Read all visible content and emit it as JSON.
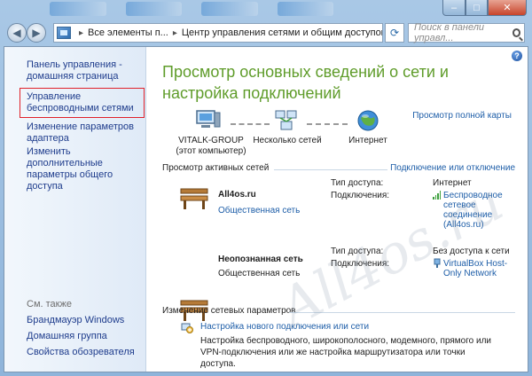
{
  "window": {
    "controls": {
      "minimize": "–",
      "maximize": "□",
      "close": "✕"
    }
  },
  "nav": {
    "back_icon": "back-arrow-icon",
    "forward_icon": "forward-arrow-icon",
    "address": {
      "crumbs": [
        "Все элементы п...",
        "Центр управления сетями и общим доступом"
      ],
      "separator": "▸"
    },
    "search_placeholder": "Поиск в панели управл..."
  },
  "sidebar": {
    "items": [
      {
        "label": "Панель управления - домашняя страница"
      },
      {
        "label": "Управление беспроводными сетями"
      },
      {
        "label": "Изменение параметров адаптера"
      },
      {
        "label": "Изменить дополнительные параметры общего доступа"
      }
    ],
    "see_also_label": "См. также",
    "see_also": [
      {
        "label": "Брандмауэр Windows"
      },
      {
        "label": "Домашняя группа"
      },
      {
        "label": "Свойства обозревателя"
      }
    ]
  },
  "main": {
    "help_label": "?",
    "title": "Просмотр основных сведений о сети и настройка подключений",
    "full_map_link": "Просмотр полной карты",
    "map": {
      "computer_name": "VITALK-GROUP",
      "computer_sub": "(этот компьютер)",
      "middle": "Несколько сетей",
      "internet": "Интернет"
    },
    "active_header": "Просмотр активных сетей",
    "connect_link": "Подключение или отключение",
    "networks": [
      {
        "name": "All4os.ru",
        "type": "Общественная сеть",
        "access_key": "Тип доступа:",
        "access_val": "Интернет",
        "conn_key": "Подключения:",
        "conn_val": "Беспроводное сетевое соединение (All4os.ru)"
      },
      {
        "name": "Неопознанная сеть",
        "type": "Общественная сеть",
        "access_key": "Тип доступа:",
        "access_val": "Без доступа к сети",
        "conn_key": "Подключения:",
        "conn_val": "VirtualBox Host-Only Network"
      }
    ],
    "change_header": "Изменение сетевых параметров",
    "tasks": [
      {
        "link": "Настройка нового подключения или сети",
        "desc": "Настройка беспроводного, широкополосного, модемного, прямого или VPN-подключения или же настройка маршрутизатора или точки доступа."
      }
    ],
    "watermark": "All4os.ru"
  }
}
